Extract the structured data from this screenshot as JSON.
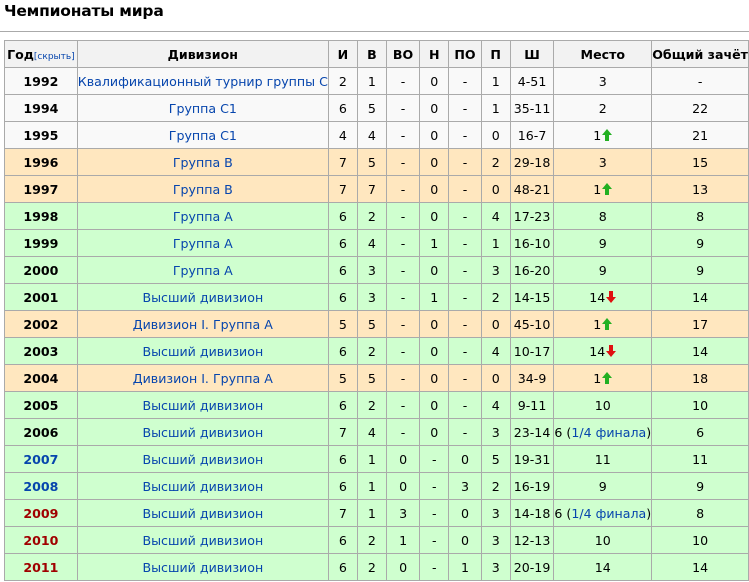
{
  "title": "Чемпионаты мира",
  "hide_label": "[скрыть]",
  "columns": [
    "Год",
    "Дивизион",
    "И",
    "В",
    "ВО",
    "Н",
    "ПО",
    "П",
    "Ш",
    "Место",
    "Общий зачёт"
  ],
  "rows": [
    {
      "year": "1992",
      "division": "Квалификационный турнир группы C",
      "gp": "2",
      "w": "1",
      "otw": "-",
      "d": "0",
      "otl": "-",
      "l": "1",
      "goals": "4-51",
      "place": "3",
      "overall": "-"
    },
    {
      "year": "1994",
      "division": "Группа C1",
      "gp": "6",
      "w": "5",
      "otw": "-",
      "d": "0",
      "otl": "-",
      "l": "1",
      "goals": "35-11",
      "place": "2",
      "overall": "22"
    },
    {
      "year": "1995",
      "division": "Группа C1",
      "gp": "4",
      "w": "4",
      "otw": "-",
      "d": "0",
      "otl": "-",
      "l": "0",
      "goals": "16-7",
      "place": "1",
      "overall": "21"
    },
    {
      "year": "1996",
      "division": "Группа B",
      "gp": "7",
      "w": "5",
      "otw": "-",
      "d": "0",
      "otl": "-",
      "l": "2",
      "goals": "29-18",
      "place": "3",
      "overall": "15"
    },
    {
      "year": "1997",
      "division": "Группа B",
      "gp": "7",
      "w": "7",
      "otw": "-",
      "d": "0",
      "otl": "-",
      "l": "0",
      "goals": "48-21",
      "place": "1",
      "overall": "13"
    },
    {
      "year": "1998",
      "division": "Группа A",
      "gp": "6",
      "w": "2",
      "otw": "-",
      "d": "0",
      "otl": "-",
      "l": "4",
      "goals": "17-23",
      "place": "8",
      "overall": "8"
    },
    {
      "year": "1999",
      "division": "Группа A",
      "gp": "6",
      "w": "4",
      "otw": "-",
      "d": "1",
      "otl": "-",
      "l": "1",
      "goals": "16-10",
      "place": "9",
      "overall": "9"
    },
    {
      "year": "2000",
      "division": "Группа A",
      "gp": "6",
      "w": "3",
      "otw": "-",
      "d": "0",
      "otl": "-",
      "l": "3",
      "goals": "16-20",
      "place": "9",
      "overall": "9"
    },
    {
      "year": "2001",
      "division": "Высший дивизион",
      "gp": "6",
      "w": "3",
      "otw": "-",
      "d": "1",
      "otl": "-",
      "l": "2",
      "goals": "14-15",
      "place": "14",
      "overall": "14"
    },
    {
      "year": "2002",
      "division": "Дивизион I. Группа A",
      "gp": "5",
      "w": "5",
      "otw": "-",
      "d": "0",
      "otl": "-",
      "l": "0",
      "goals": "45-10",
      "place": "1",
      "overall": "17"
    },
    {
      "year": "2003",
      "division": "Высший дивизион",
      "gp": "6",
      "w": "2",
      "otw": "-",
      "d": "0",
      "otl": "-",
      "l": "4",
      "goals": "10-17",
      "place": "14",
      "overall": "14"
    },
    {
      "year": "2004",
      "division": "Дивизион I. Группа A",
      "gp": "5",
      "w": "5",
      "otw": "-",
      "d": "0",
      "otl": "-",
      "l": "0",
      "goals": "34-9",
      "place": "1",
      "overall": "18"
    },
    {
      "year": "2005",
      "division": "Высший дивизион",
      "gp": "6",
      "w": "2",
      "otw": "-",
      "d": "0",
      "otl": "-",
      "l": "4",
      "goals": "9-11",
      "place": "10",
      "overall": "10"
    },
    {
      "year": "2006",
      "division": "Высший дивизион",
      "gp": "7",
      "w": "4",
      "otw": "-",
      "d": "0",
      "otl": "-",
      "l": "3",
      "goals": "23-14",
      "place": "6",
      "place_note_pre": " (",
      "place_link": "1/4 финала",
      "place_note_post": ")",
      "overall": "6"
    },
    {
      "year": "2007",
      "division": "Высший дивизион",
      "gp": "6",
      "w": "1",
      "otw": "0",
      "d": "-",
      "otl": "0",
      "l": "5",
      "goals": "19-31",
      "place": "11",
      "overall": "11"
    },
    {
      "year": "2008",
      "division": "Высший дивизион",
      "gp": "6",
      "w": "1",
      "otw": "0",
      "d": "-",
      "otl": "3",
      "l": "2",
      "goals": "16-19",
      "place": "9",
      "overall": "9"
    },
    {
      "year": "2009",
      "division": "Высший дивизион",
      "gp": "7",
      "w": "1",
      "otw": "3",
      "d": "-",
      "otl": "0",
      "l": "3",
      "goals": "14-18",
      "place": "6",
      "place_note_pre": " (",
      "place_link": "1/4 финала",
      "place_note_post": ")",
      "overall": "8"
    },
    {
      "year": "2010",
      "division": "Высший дивизион",
      "gp": "6",
      "w": "2",
      "otw": "1",
      "d": "-",
      "otl": "0",
      "l": "3",
      "goals": "12-13",
      "place": "10",
      "overall": "10"
    },
    {
      "year": "2011",
      "division": "Высший дивизион",
      "gp": "6",
      "w": "2",
      "otw": "0",
      "d": "-",
      "otl": "1",
      "l": "3",
      "goals": "20-19",
      "place": "14",
      "overall": "14"
    }
  ],
  "row_style": [
    "w",
    "w",
    "w",
    "o",
    "o",
    "g",
    "g",
    "g",
    "g",
    "o",
    "g",
    "o",
    "g",
    "g",
    "g",
    "g",
    "g",
    "g",
    "g"
  ],
  "year_style": [
    "",
    "",
    "",
    "",
    "",
    "",
    "",
    "",
    "",
    "",
    "",
    "",
    "",
    "",
    "blue",
    "blue",
    "red",
    "red",
    "red"
  ],
  "place_arrow": [
    "",
    "",
    "up",
    "",
    "up",
    "",
    "",
    "",
    "down",
    "up",
    "down",
    "up",
    "",
    "",
    "",
    "",
    "",
    "",
    ""
  ],
  "colors": {
    "header_bg": "#f2f2f2",
    "white_row": "#f9f9f9",
    "orange_row": "#ffe7bf",
    "green_row": "#cfffcf",
    "link": "#0645ad",
    "red_year": "#a00000",
    "up_arrow": "#22b022",
    "down_arrow": "#e01010"
  },
  "icons": {
    "up": "green-up-arrow-icon",
    "down": "red-down-arrow-icon"
  }
}
